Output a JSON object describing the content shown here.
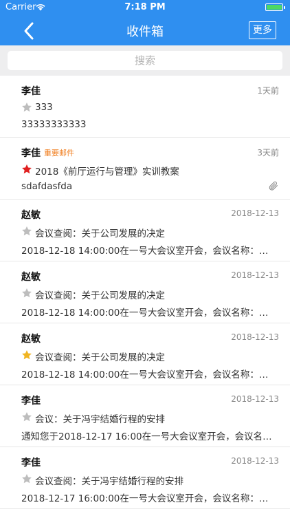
{
  "status_bar": {
    "carrier": "Carrier",
    "time": "7:18 PM"
  },
  "nav": {
    "title": "收件箱",
    "more_label": "更多"
  },
  "search": {
    "placeholder": "搜索"
  },
  "colors": {
    "accent": "#2f8ff0",
    "star_off": "#bdbdbd",
    "star_red": "#e02020",
    "star_gold": "#f0b422",
    "tag": "#f07d1d"
  },
  "mails": [
    {
      "sender": "李佳",
      "tag": "",
      "date": "1天前",
      "star": "off",
      "subject": "333",
      "preview": "33333333333",
      "attachment": false
    },
    {
      "sender": "李佳",
      "tag": "重要邮件",
      "date": "3天前",
      "star": "red",
      "subject": "2018《前厅运行与管理》实训教案",
      "preview": "sdafdasfda",
      "attachment": true
    },
    {
      "sender": "赵敏",
      "tag": "",
      "date": "2018-12-13",
      "star": "off",
      "subject": "会议查阅：关于公司发展的决定",
      "preview": "2018-12-18 14:00:00在一号大会议室开会，会议名称：…",
      "attachment": false
    },
    {
      "sender": "赵敏",
      "tag": "",
      "date": "2018-12-13",
      "star": "off",
      "subject": "会议查阅：关于公司发展的决定",
      "preview": "2018-12-18 14:00:00在一号大会议室开会，会议名称：…",
      "attachment": false
    },
    {
      "sender": "赵敏",
      "tag": "",
      "date": "2018-12-13",
      "star": "gold",
      "subject": "会议查阅：关于公司发展的决定",
      "preview": "2018-12-18 14:00:00在一号大会议室开会，会议名称：…",
      "attachment": false
    },
    {
      "sender": "李佳",
      "tag": "",
      "date": "2018-12-13",
      "star": "off",
      "subject": "会议：关于冯宇结婚行程的安排",
      "preview": "通知您于2018-12-17 16:00在一号大会议室开会，会议名…",
      "attachment": false
    },
    {
      "sender": "李佳",
      "tag": "",
      "date": "2018-12-13",
      "star": "off",
      "subject": "会议查阅：关于冯宇结婚行程的安排",
      "preview": "2018-12-17 16:00:00在一号大会议室开会，会议名称：…",
      "attachment": false
    }
  ]
}
